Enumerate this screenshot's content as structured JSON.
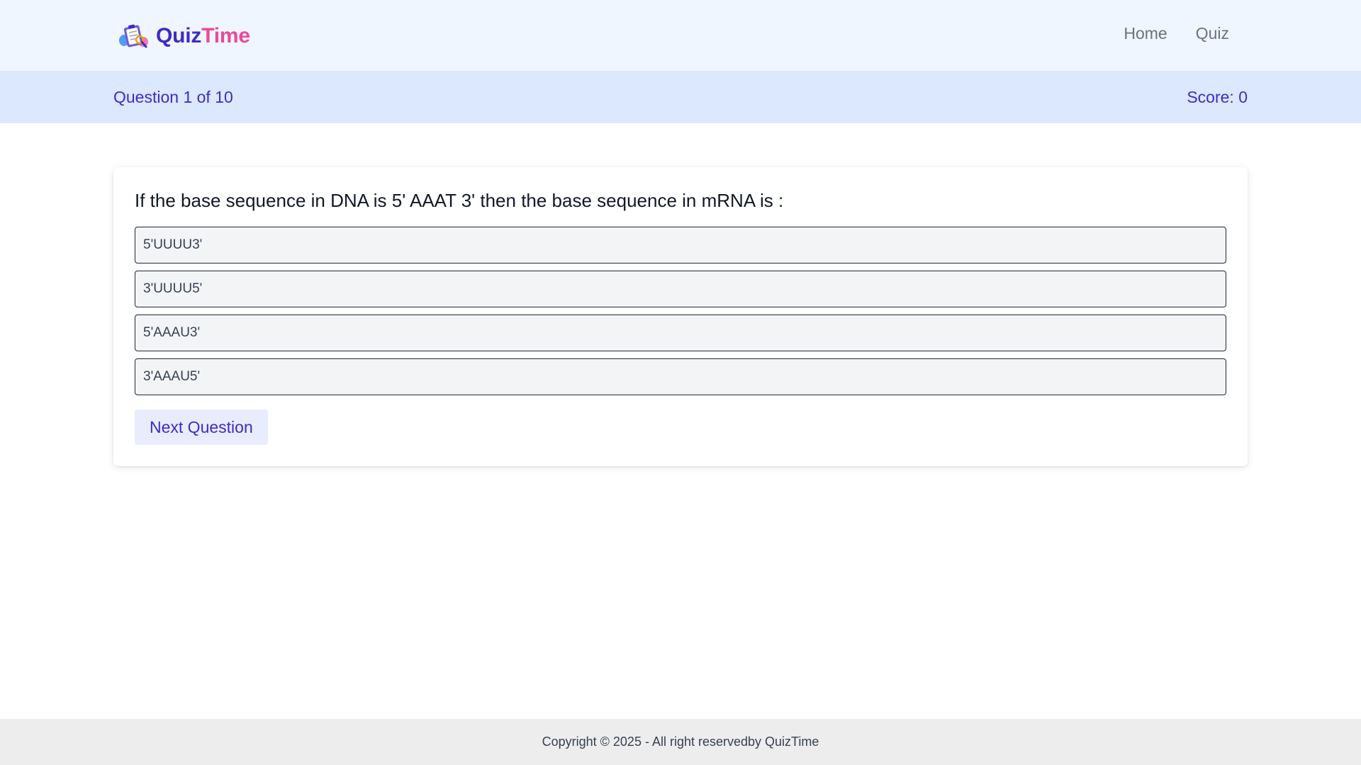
{
  "navbar": {
    "brand": {
      "part1": "Quiz",
      "part2": "Time",
      "logo_icon": "quiz-clipboard-logo-icon"
    },
    "links": [
      {
        "label": "Home"
      },
      {
        "label": "Quiz"
      }
    ]
  },
  "status": {
    "progress_text": "Question 1 of 10",
    "score_text": "Score: 0"
  },
  "quiz": {
    "question": "If the base sequence in DNA is 5' AAAT 3' then the base sequence in mRNA is :",
    "options": [
      "5'UUUU3'",
      "3'UUUU5'",
      "5'AAAU3'",
      "3'AAAU5'"
    ],
    "next_label": "Next Question"
  },
  "footer": {
    "copyright": "Copyright © 2025 - All right reservedby QuizTime"
  },
  "colors": {
    "brand_primary": "#3f2bc4",
    "brand_accent": "#ec4899",
    "navbar_bg": "#eff6ff",
    "statusbar_bg": "#dbe8fe",
    "option_bg": "#f3f4f6",
    "footer_bg": "#ededed"
  }
}
